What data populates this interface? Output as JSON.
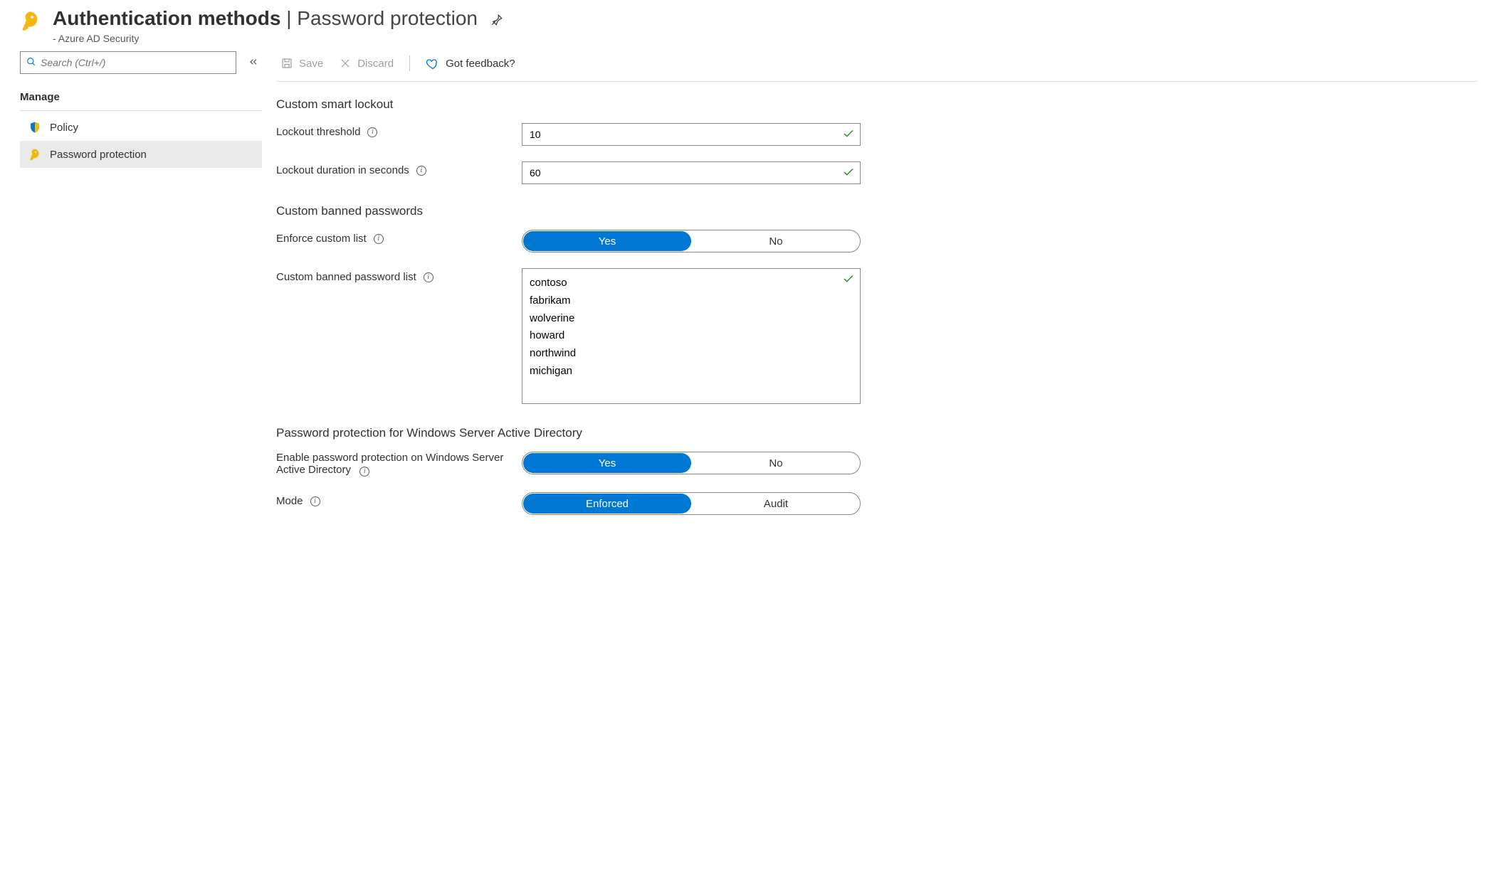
{
  "header": {
    "title": "Authentication methods",
    "separator": " | ",
    "subtitle": "Password protection",
    "subtext": " - Azure AD Security"
  },
  "sidebar": {
    "search_placeholder": "Search (Ctrl+/)",
    "manage_label": "Manage",
    "items": {
      "policy": "Policy",
      "password_protection": "Password protection"
    }
  },
  "toolbar": {
    "save": "Save",
    "discard": "Discard",
    "feedback": "Got feedback?"
  },
  "form": {
    "sections": {
      "lockout": {
        "title": "Custom smart lockout",
        "threshold_label": "Lockout threshold",
        "threshold_value": "10",
        "duration_label": "Lockout duration in seconds",
        "duration_value": "60"
      },
      "banned": {
        "title": "Custom banned passwords",
        "enforce_label": "Enforce custom list",
        "enforce_yes": "Yes",
        "enforce_no": "No",
        "list_label": "Custom banned password list",
        "list_value": "contoso\nfabrikam\nwolverine\nhoward\nnorthwind\nmichigan"
      },
      "winserver": {
        "title": "Password protection for Windows Server Active Directory",
        "enable_label": "Enable password protection on Windows Server Active Directory",
        "enable_yes": "Yes",
        "enable_no": "No",
        "mode_label": "Mode",
        "mode_enforced": "Enforced",
        "mode_audit": "Audit"
      }
    }
  }
}
